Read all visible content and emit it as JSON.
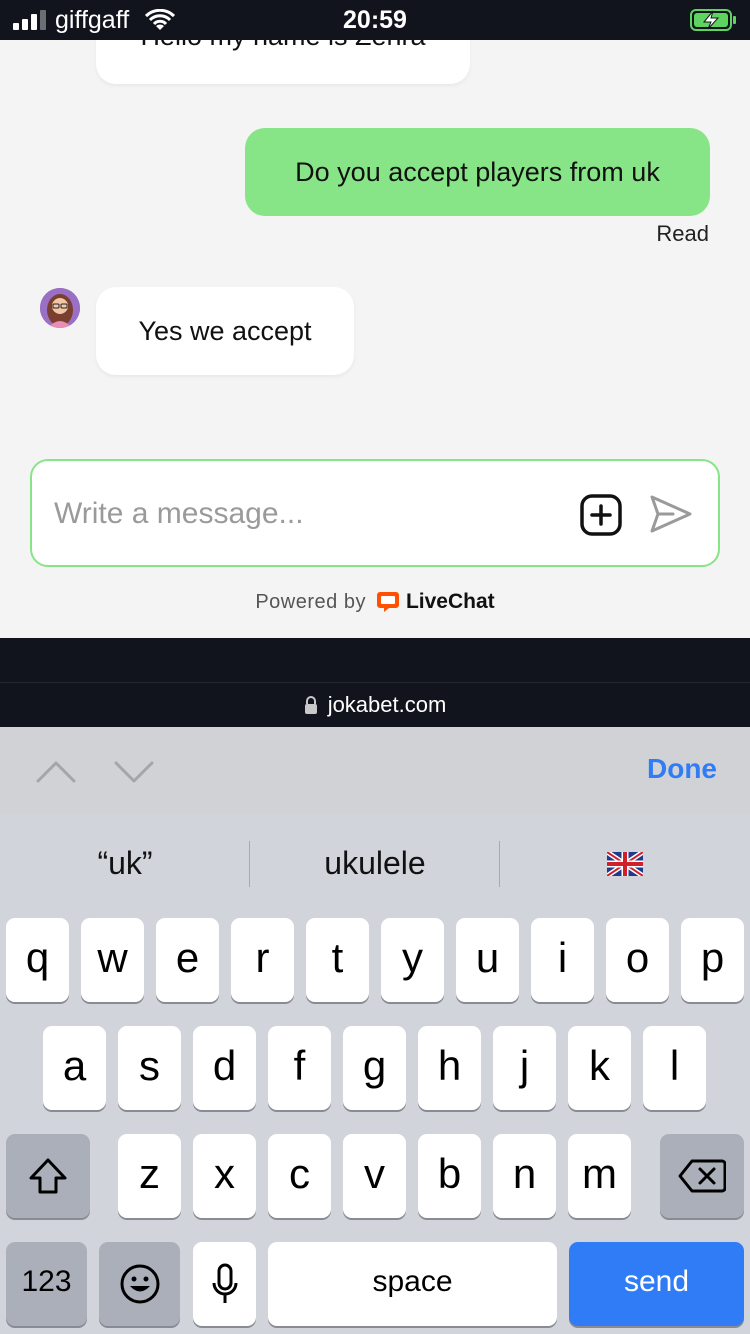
{
  "status_bar": {
    "carrier": "giffgaff",
    "time": "20:59"
  },
  "chat": {
    "previous_message": "Hello my name is Zehra",
    "my_message": "Do you accept players from uk",
    "read_status": "Read",
    "reply_message": "Yes we accept",
    "composer_placeholder": "Write a message...",
    "powered_by": "Powered by",
    "brand": "LiveChat",
    "colors": {
      "my_bubble": "#88e587",
      "brand_accent": "#ff5100"
    }
  },
  "browser": {
    "url": "jokabet.com"
  },
  "accessory": {
    "done_label": "Done"
  },
  "suggestions": [
    "“uk”",
    "ukulele",
    "🇬🇧"
  ],
  "keyboard": {
    "row1": [
      "q",
      "w",
      "e",
      "r",
      "t",
      "y",
      "u",
      "i",
      "o",
      "p"
    ],
    "row2": [
      "a",
      "s",
      "d",
      "f",
      "g",
      "h",
      "j",
      "k",
      "l"
    ],
    "row3": [
      "z",
      "x",
      "c",
      "v",
      "b",
      "n",
      "m"
    ],
    "numbers_label": "123",
    "space_label": "space",
    "send_label": "send"
  }
}
